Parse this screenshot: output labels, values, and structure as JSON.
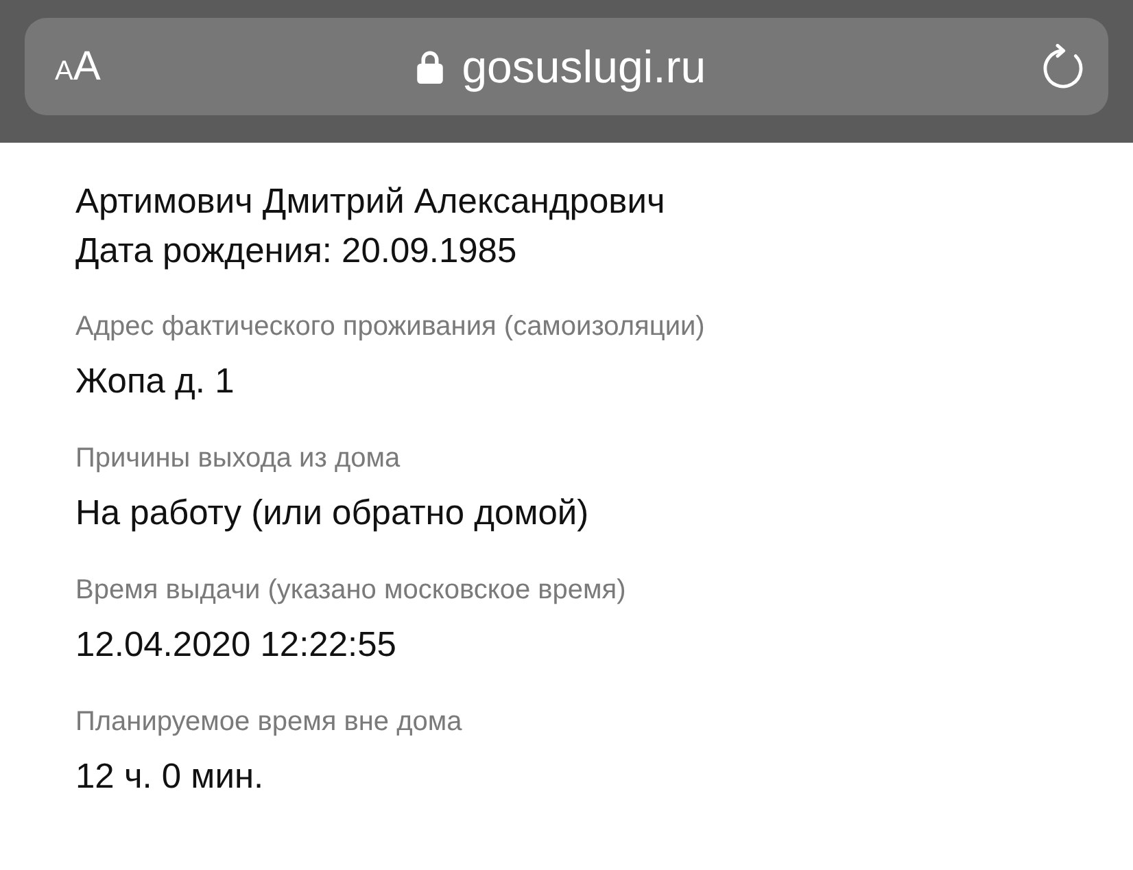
{
  "address_bar": {
    "text_size_button": {
      "small_letter": "A",
      "large_letter": "A"
    },
    "url": "gosuslugi.ru",
    "secure": true
  },
  "person": {
    "name": "Артимович Дмитрий Александрович",
    "birth_date_line": "Дата рождения: 20.09.1985"
  },
  "fields": [
    {
      "label": "Адрес фактического проживания (самоизоляции)",
      "value": "Жопа д. 1"
    },
    {
      "label": "Причины выхода из дома",
      "value": "На работу (или обратно домой)"
    },
    {
      "label": "Время выдачи (указано московское время)",
      "value": "12.04.2020 12:22:55"
    },
    {
      "label": "Планируемое время вне дома",
      "value": "12 ч. 0 мин."
    }
  ]
}
